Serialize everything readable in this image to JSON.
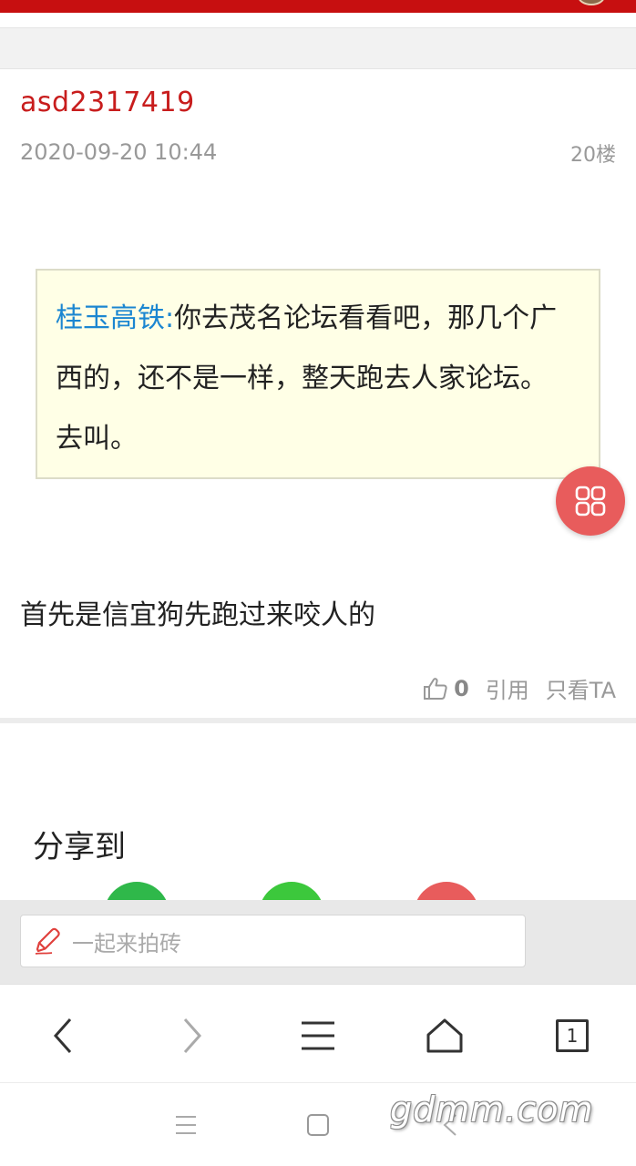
{
  "post": {
    "username": "asd2317419",
    "time": "2020-09-20 10:44",
    "floor": "20楼",
    "quote": {
      "author": "桂玉高铁:",
      "text": "你去茂名论坛看看吧，那几个广西的，还不是一样，整天跑去人家论坛。去叫。"
    },
    "body": "首先是信宜狗先跑过来咬人的",
    "actions": {
      "like_count": "0",
      "quote_label": "引用",
      "only_view_label": "只看TA"
    }
  },
  "share": {
    "title": "分享到",
    "colors": [
      "#2fb84a",
      "#3cc83c",
      "#e85c5c"
    ]
  },
  "reply": {
    "placeholder": "一起来拍砖"
  },
  "browser_nav": {
    "tab_count": "1"
  },
  "watermark": "gdmm.com",
  "colors": {
    "accent_red": "#c70f10",
    "username_red": "#c81d1d",
    "quote_author_blue": "#1b86d1",
    "quote_bg": "#ffffe6",
    "fab_red": "#e85c5c"
  }
}
